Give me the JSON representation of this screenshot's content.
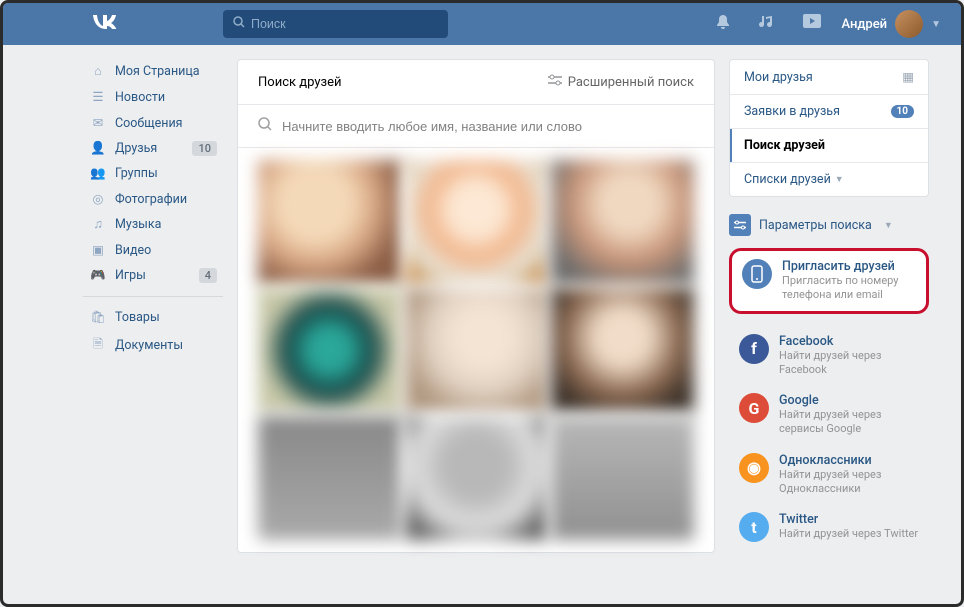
{
  "header": {
    "search_placeholder": "Поиск",
    "username": "Андрей"
  },
  "sidebar": {
    "items": [
      {
        "icon": "home",
        "label": "Моя Страница"
      },
      {
        "icon": "news",
        "label": "Новости"
      },
      {
        "icon": "msg",
        "label": "Сообщения"
      },
      {
        "icon": "friends",
        "label": "Друзья",
        "badge": "10"
      },
      {
        "icon": "groups",
        "label": "Группы"
      },
      {
        "icon": "photo",
        "label": "Фотографии"
      },
      {
        "icon": "music",
        "label": "Музыка"
      },
      {
        "icon": "video",
        "label": "Видео"
      },
      {
        "icon": "games",
        "label": "Игры",
        "badge": "4"
      }
    ],
    "items2": [
      {
        "icon": "market",
        "label": "Товары"
      },
      {
        "icon": "docs",
        "label": "Документы"
      }
    ]
  },
  "main": {
    "title": "Поиск друзей",
    "extended": "Расширенный поиск",
    "placeholder": "Начните вводить любое имя, название или слово"
  },
  "right": {
    "nav": [
      {
        "label": "Мои друзья",
        "cal": true
      },
      {
        "label": "Заявки в друзья",
        "count": "10"
      },
      {
        "label": "Поиск друзей",
        "active": true
      },
      {
        "label": "Списки друзей",
        "drop": true
      }
    ],
    "params": "Параметры поиска",
    "invite": {
      "title": "Пригласить друзей",
      "sub": "Пригласить по номеру телефона или email"
    },
    "socials": [
      {
        "name": "Facebook",
        "sub": "Найти друзей через Facebook",
        "bg": "#3b5998",
        "glyph": "f"
      },
      {
        "name": "Google",
        "sub": "Найти друзей через сервисы Google",
        "bg": "#dd4b39",
        "glyph": "G"
      },
      {
        "name": "Одноклассники",
        "sub": "Найти друзей через Одноклассники",
        "bg": "#f7931e",
        "glyph": "◉"
      },
      {
        "name": "Twitter",
        "sub": "Найти друзей через Twitter",
        "bg": "#55acee",
        "glyph": "t"
      }
    ]
  }
}
